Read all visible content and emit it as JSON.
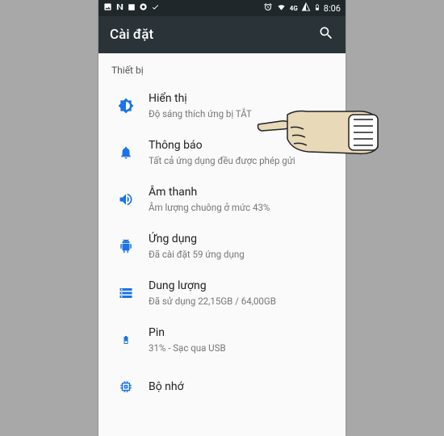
{
  "status": {
    "network_label": "4G",
    "time": "8:06"
  },
  "appbar": {
    "title": "Cài đặt"
  },
  "section": {
    "header": "Thiết bị"
  },
  "items": [
    {
      "title": "Hiển thị",
      "subtitle": "Độ sáng thích ứng bị TẮT"
    },
    {
      "title": "Thông báo",
      "subtitle": "Tất cả ứng dụng đều được phép gửi"
    },
    {
      "title": "Âm thanh",
      "subtitle": "Âm lượng chuông ở mức 43%"
    },
    {
      "title": "Ứng dụng",
      "subtitle": "Đã cài đặt 59 ứng dụng"
    },
    {
      "title": "Dung lượng",
      "subtitle": "Đã sử dụng 22,15GB / 64,00GB"
    },
    {
      "title": "Pin",
      "subtitle": "31% - Sạc qua USB"
    },
    {
      "title": "Bộ nhớ",
      "subtitle": ""
    }
  ],
  "colors": {
    "accent": "#1a73e8",
    "statusbar": "#1f272b",
    "appbar": "#2a3338"
  }
}
